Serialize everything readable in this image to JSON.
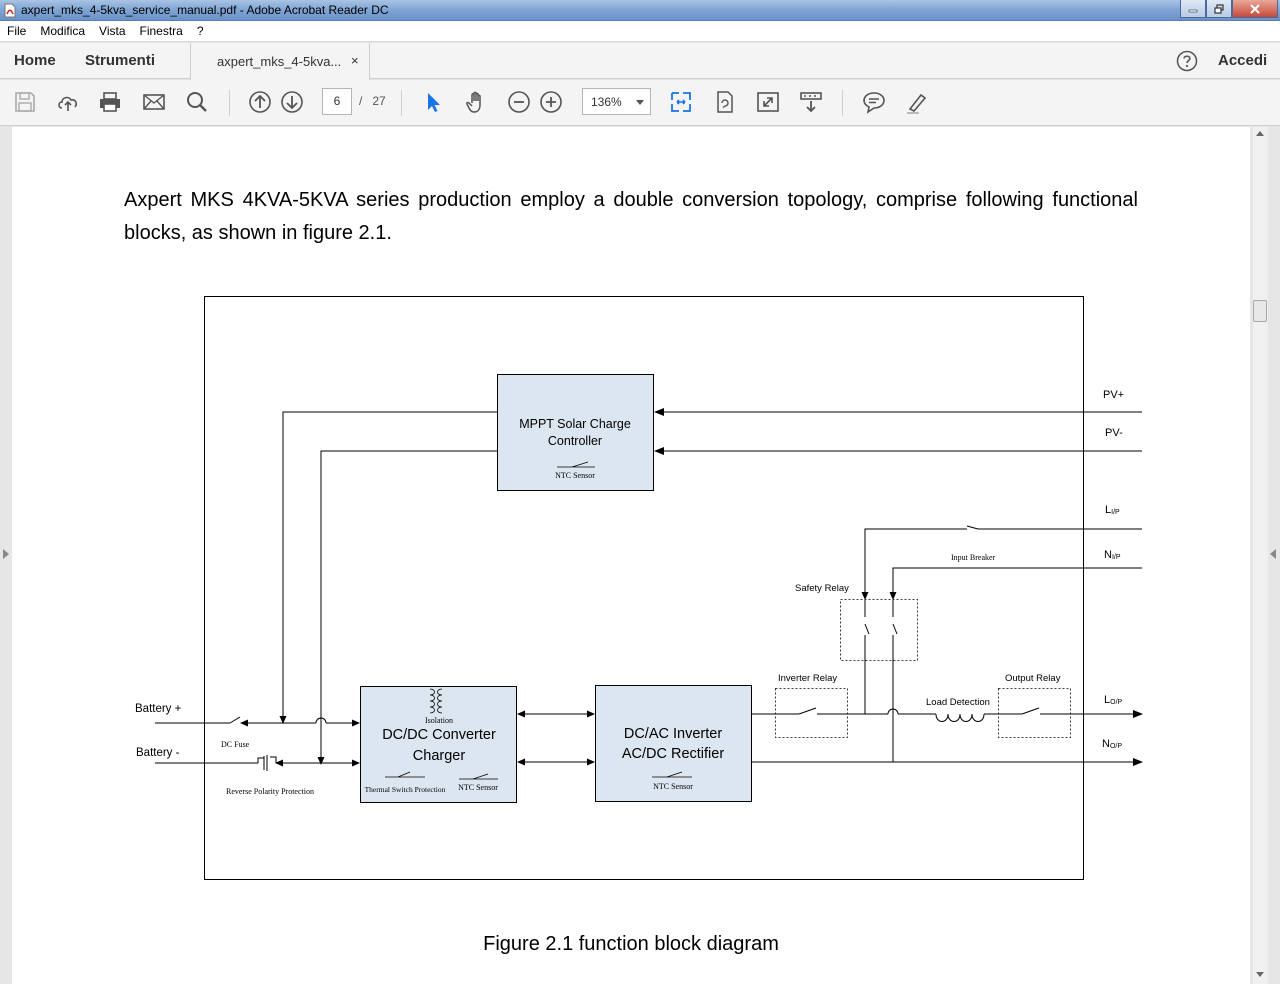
{
  "window": {
    "title": "axpert_mks_4-5kva_service_manual.pdf - Adobe Acrobat Reader DC"
  },
  "menu": {
    "items": [
      "File",
      "Modifica",
      "Vista",
      "Finestra",
      "?"
    ]
  },
  "tabs": {
    "home": "Home",
    "tools": "Strumenti",
    "document": "axpert_mks_4-5kva...",
    "close": "×",
    "sign_in": "Accedi"
  },
  "toolbar": {
    "current_page": "6",
    "page_separator": "/",
    "total_pages": "27",
    "zoom": "136%"
  },
  "document": {
    "paragraph": "Axpert MKS 4KVA-5KVA series production employ a double conversion topology, comprise following functional blocks, as shown in figure 2.1.",
    "caption": "Figure 2.1 function block diagram"
  },
  "diagram": {
    "mppt_line1": "MPPT  Solar Charge",
    "mppt_line2": "Controller",
    "mppt_ntc": "NTC Sensor",
    "pv_plus": "PV+",
    "pv_minus": "PV-",
    "l_in": "L",
    "l_in_sub": "I/P",
    "n_in": "N",
    "n_in_sub": "I/P",
    "input_breaker": "Input Breaker",
    "safety_relay": "Safety Relay",
    "inverter_relay": "Inverter Relay",
    "load_detection": "Load Detection",
    "output_relay": "Output Relay",
    "l_out": "L",
    "l_out_sub": "O/P",
    "n_out": "N",
    "n_out_sub": "O/P",
    "battery_plus": "Battery +",
    "battery_minus": "Battery -",
    "dc_fuse": "DC Fuse",
    "reverse_polarity": "Reverse Polarity Protection",
    "isolation": "Isolation",
    "dcdc_line1": "DC/DC Converter",
    "dcdc_line2": "Charger",
    "thermal_switch": "Thermal Switch Protection",
    "dcdc_ntc": "NTC Sensor",
    "inv_line1": "DC/AC Inverter",
    "inv_line2": "AC/DC Rectifier",
    "inv_ntc": "NTC Sensor"
  }
}
